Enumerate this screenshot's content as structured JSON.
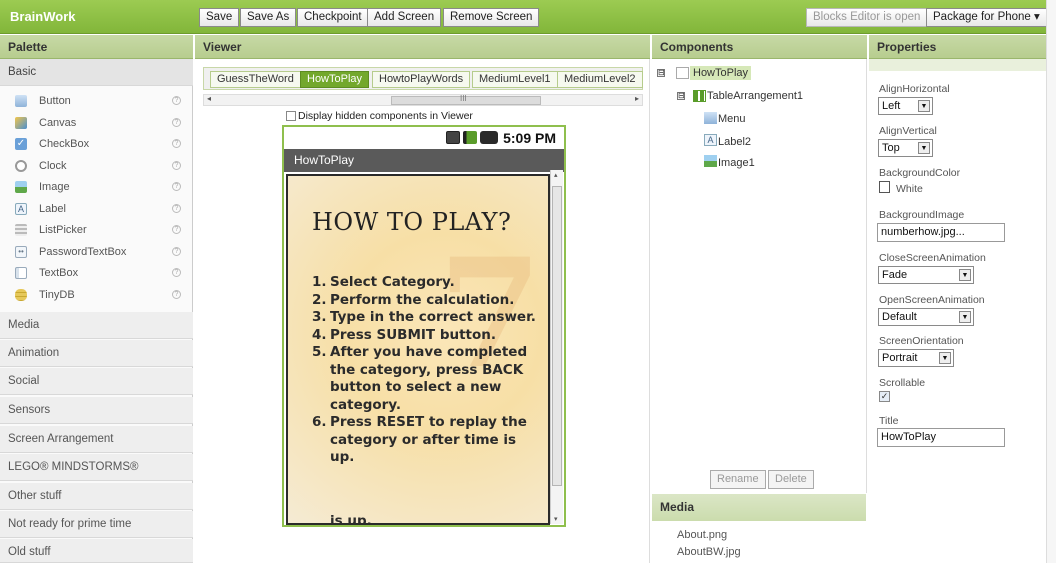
{
  "app": {
    "brand": "BrainWork"
  },
  "toolbar": {
    "save": "Save",
    "save_as": "Save As",
    "checkpoint": "Checkpoint",
    "add_screen": "Add Screen",
    "remove_screen": "Remove Screen",
    "blocks_editor": "Blocks Editor is open",
    "package": "Package for Phone ▾"
  },
  "headers": {
    "palette": "Palette",
    "viewer": "Viewer",
    "components": "Components",
    "properties": "Properties",
    "media": "Media"
  },
  "palette": {
    "basic": "Basic",
    "items": [
      "Button",
      "Canvas",
      "CheckBox",
      "Clock",
      "Image",
      "Label",
      "ListPicker",
      "PasswordTextBox",
      "TextBox",
      "TinyDB"
    ],
    "help": "?",
    "categories": [
      "Media",
      "Animation",
      "Social",
      "Sensors",
      "Screen Arrangement",
      "LEGO® MINDSTORMS®",
      "Other stuff",
      "Not ready for prime time",
      "Old stuff"
    ]
  },
  "viewer": {
    "tabs": [
      "GuessTheWord",
      "HowToPlay",
      "HowtoPlayWords",
      "MediumLevel1",
      "MediumLevel2"
    ],
    "selected_tab": "HowToPlay",
    "hscroll_mark": "III",
    "hidden_components_label": "Display hidden components in Viewer",
    "phone": {
      "clock": "5:09 PM",
      "title": "HowToPlay",
      "image_title": "HOW TO PLAY?",
      "steps": [
        {
          "n": "1.",
          "text": "Select Category."
        },
        {
          "n": "2.",
          "text": "Perform the calculation."
        },
        {
          "n": "3.",
          "text": "Type in the correct answer."
        },
        {
          "n": "4.",
          "text": "Press SUBMIT button."
        },
        {
          "n": "5.",
          "text": "After you have completed the category, press BACK button to select a new category."
        },
        {
          "n": "6.",
          "text": "Press RESET to replay the category or after time is up."
        }
      ],
      "overflow_text": "is up."
    }
  },
  "components": {
    "tree": {
      "root": "HowToPlay",
      "arrangement": "TableArrangement1",
      "children": [
        "Menu",
        "Label2",
        "Image1"
      ]
    },
    "toggle_expanded": "⊟",
    "rename": "Rename",
    "delete": "Delete"
  },
  "media": {
    "items": [
      "About.png",
      "AboutBW.jpg"
    ]
  },
  "properties": {
    "align_horizontal": {
      "label": "AlignHorizontal",
      "value": "Left"
    },
    "align_vertical": {
      "label": "AlignVertical",
      "value": "Top"
    },
    "background_color": {
      "label": "BackgroundColor",
      "value": "White"
    },
    "background_image": {
      "label": "BackgroundImage",
      "value": "numberhow.jpg..."
    },
    "close_screen_animation": {
      "label": "CloseScreenAnimation",
      "value": "Fade"
    },
    "open_screen_animation": {
      "label": "OpenScreenAnimation",
      "value": "Default"
    },
    "screen_orientation": {
      "label": "ScreenOrientation",
      "value": "Portrait"
    },
    "scrollable": {
      "label": "Scrollable",
      "checked": true,
      "mark": "✓"
    },
    "title": {
      "label": "Title",
      "value": "HowToPlay"
    }
  },
  "colors": {
    "accent": "#8fc04b",
    "selected_tab": "#73a82c",
    "title_bar": "#5a5a5a"
  }
}
